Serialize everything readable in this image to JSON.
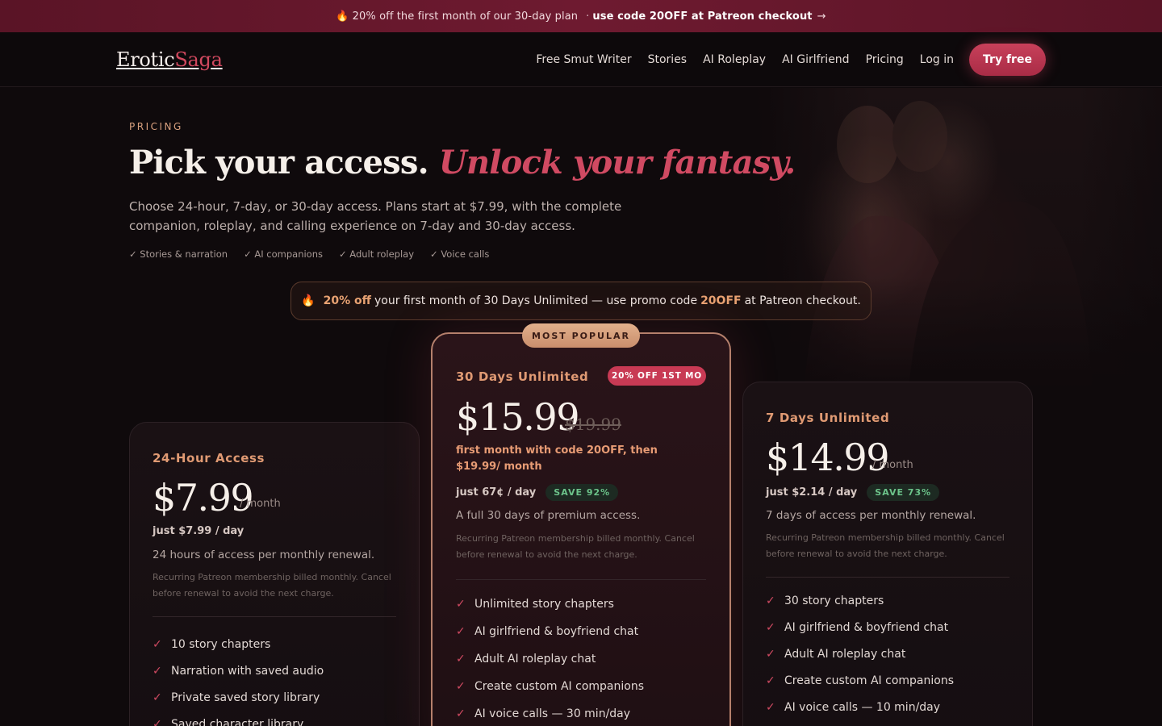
{
  "promo_bar": {
    "fire": "🔥",
    "text": "20% off the first month of our 30-day plan",
    "separator": "·",
    "link": "use code 20OFF at Patreon checkout",
    "arrow": "→"
  },
  "nav": {
    "logo_main": "Erotic",
    "logo_accent": "Saga",
    "links": [
      "Free Smut Writer",
      "Stories",
      "AI Roleplay",
      "AI Girlfriend",
      "Pricing",
      "Log in"
    ],
    "cta": "Try free"
  },
  "hero": {
    "eyebrow": "PRICING",
    "headline_plain": "Pick your access.",
    "headline_italic": "Unlock your fantasy.",
    "description": "Choose 24-hour, 7-day, or 30-day access. Plans start at $7.99, with the complete companion, roleplay, and calling experience on 7-day and 30-day access.",
    "ticks": [
      "✓ Stories & narration",
      "✓ AI companions",
      "✓ Adult roleplay",
      "✓ Voice calls"
    ]
  },
  "promo_pill": {
    "fire": "🔥",
    "bold1": "20% off",
    "text1": "your first month of 30 Days Unlimited — use promo code",
    "bold2": "20OFF",
    "text2": "at Patreon checkout."
  },
  "plans": {
    "day": {
      "title": "24-Hour Access",
      "price": "$7.99",
      "per": "/ month",
      "perday": "just $7.99 / day",
      "desc": "24 hours of access per monthly renewal.",
      "fine": "Recurring Patreon membership billed monthly. Cancel before renewal to avoid the next charge.",
      "features": [
        "10 story chapters",
        "Narration with saved audio",
        "Private saved story library",
        "Saved character library"
      ]
    },
    "month": {
      "popular": "MOST POPULAR",
      "title": "30 Days Unlimited",
      "badge": "20% OFF 1ST MO",
      "price": "$15.99",
      "strike": "$19.99",
      "first_month": "first month with code 20OFF, then $19.99/ month",
      "perday": "just 67¢ / day",
      "save": "SAVE 92%",
      "desc": "A full 30 days of premium access.",
      "fine": "Recurring Patreon membership billed monthly. Cancel before renewal to avoid the next charge.",
      "features": [
        "Unlimited story chapters",
        "AI girlfriend & boyfriend chat",
        "Adult AI roleplay chat",
        "Create custom AI companions",
        "AI voice calls — 30 min/day"
      ]
    },
    "week": {
      "title": "7 Days Unlimited",
      "price": "$14.99",
      "per": "/ month",
      "perday": "just $2.14 / day",
      "save": "SAVE 73%",
      "desc": "7 days of access per monthly renewal.",
      "fine": "Recurring Patreon membership billed monthly. Cancel before renewal to avoid the next charge.",
      "features": [
        "30 story chapters",
        "AI girlfriend & boyfriend chat",
        "Adult AI roleplay chat",
        "Create custom AI companions",
        "AI voice calls — 10 min/day"
      ]
    }
  },
  "colors": {
    "accent": "#d04a62",
    "gold": "#e09a73",
    "background": "#0f0a0c"
  }
}
